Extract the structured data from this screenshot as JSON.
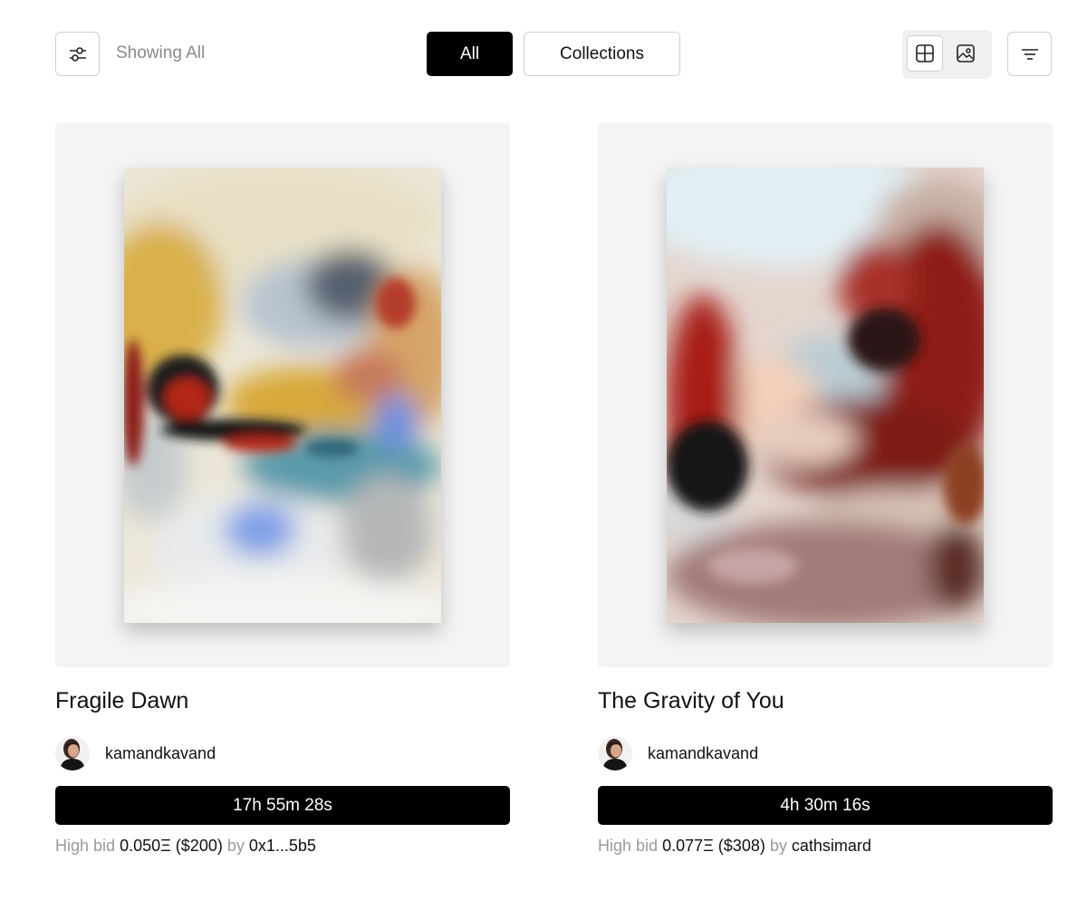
{
  "toolbar": {
    "filter_icon": "sliders-icon",
    "showing_label": "Showing All",
    "tabs": [
      {
        "label": "All",
        "active": true
      },
      {
        "label": "Collections",
        "active": false
      }
    ],
    "view_options": [
      {
        "icon": "grid-icon",
        "active": true
      },
      {
        "icon": "image-icon",
        "active": false
      }
    ],
    "sort_icon": "sort-lines-icon"
  },
  "artworks": [
    {
      "title": "Fragile Dawn",
      "creator": "kamandkavand",
      "timer": "17h 55m 28s",
      "bid_label": "High bid",
      "bid_amount": "0.050Ξ ($200)",
      "bid_by_label": "by",
      "bidder": "0x1...5b5"
    },
    {
      "title": "The Gravity of You",
      "creator": "kamandkavand",
      "timer": "4h 30m 16s",
      "bid_label": "High bid",
      "bid_amount": "0.077Ξ ($308)",
      "bid_by_label": "by",
      "bidder": "cathsimard"
    }
  ]
}
